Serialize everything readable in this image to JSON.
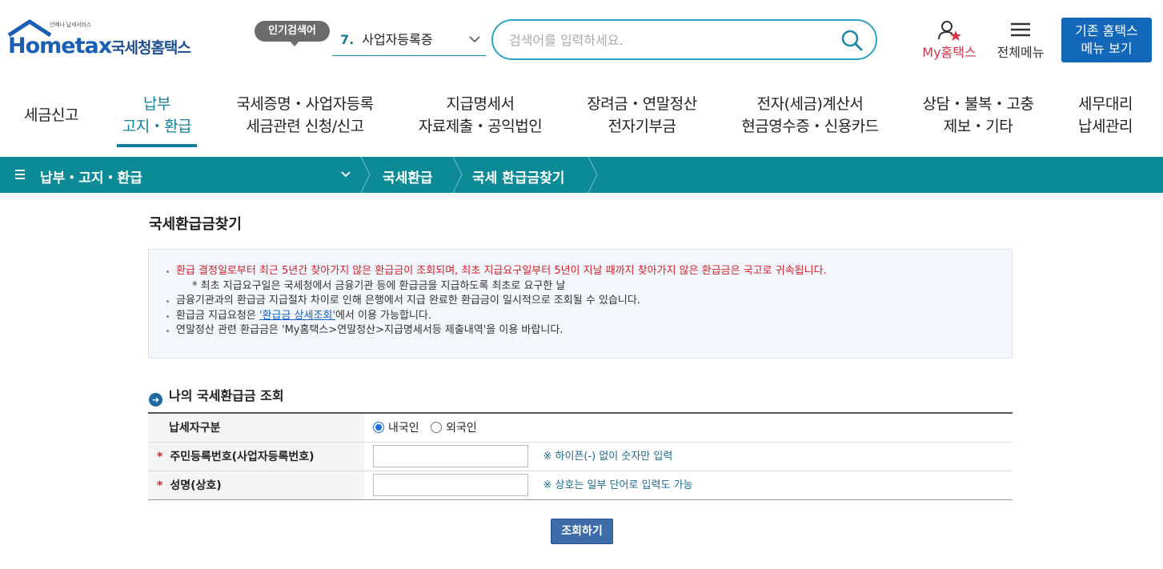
{
  "header": {
    "logo_tagline": "언제나 납세서비스",
    "logo_brand": "Hometax",
    "logo_korean": "국세청홈택스",
    "popular_badge": "인기검색어",
    "popular_number": "7.",
    "popular_term": "사업자등록증",
    "search_placeholder": "검색어를 입력하세요.",
    "my_hometax": "My홈택스",
    "all_menu": "전체메뉴",
    "legacy_line1": "기존 홈택스",
    "legacy_line2": "메뉴 보기"
  },
  "nav": [
    {
      "line1": "세금신고",
      "line2": ""
    },
    {
      "line1": "납부",
      "line2": "고지・환급"
    },
    {
      "line1": "국세증명・사업자등록",
      "line2": "세금관련 신청/신고"
    },
    {
      "line1": "지급명세서",
      "line2": "자료제출・공익법인"
    },
    {
      "line1": "장려금・연말정산",
      "line2": "전자기부금"
    },
    {
      "line1": "전자(세금)계산서",
      "line2": "현금영수증・신용카드"
    },
    {
      "line1": "상담・불복・고충",
      "line2": "제보・기타"
    },
    {
      "line1": "세무대리",
      "line2": "납세관리"
    }
  ],
  "breadcrumb": {
    "level1": "납부・고지・환급",
    "level2": "국세환급",
    "level3": "국세 환급금찾기"
  },
  "page_title": "국세환급금찾기",
  "notice": {
    "line1": "환급 결정일로부터 최근 5년간 찾아가지 않은 환급금이 조회되며, 최초 지급요구일부터 5년이 지날 때까지 찾아가지 않은 환급금은 국고로 귀속됩니다.",
    "line1_sub": "* 최초 지급요구일은 국세청에서 금융기관 등에 환급금을 지급하도록 최초로 요구한 날",
    "line2": "금융기관과의 환급금 지급절차 차이로 인해 은행에서 지급 완료한 환급금이 일시적으로 조회될 수 있습니다.",
    "line3_pre": "환급금 지급요청은 ",
    "line3_link": "'환급금 상세조회'",
    "line3_post": "에서 이용 가능합니다.",
    "line4": "연말정산 관련 환급금은 'My홈택스>연말정산>지급명세서등 제출내역'을 이용 바랍니다."
  },
  "section_title": "나의 국세환급금 조회",
  "form": {
    "taxpayer_type_label": "납세자구분",
    "option_domestic": "내국인",
    "option_foreign": "외국인",
    "selected": "내국인",
    "id_label": "주민등록번호(사업자등록번호)",
    "id_value": "",
    "id_hint": "※ 하이픈(-) 없이 숫자만 입력",
    "name_label": "성명(상호)",
    "name_value": "",
    "name_hint": "※ 상호는 일부 단어로 입력도 가능",
    "required_mark": "*"
  },
  "query_button": "조회하기",
  "colors": {
    "teal": "#0c8a96",
    "brand_blue": "#1267b8",
    "warning_red": "#d4202a",
    "accent_pink": "#d8334a"
  }
}
